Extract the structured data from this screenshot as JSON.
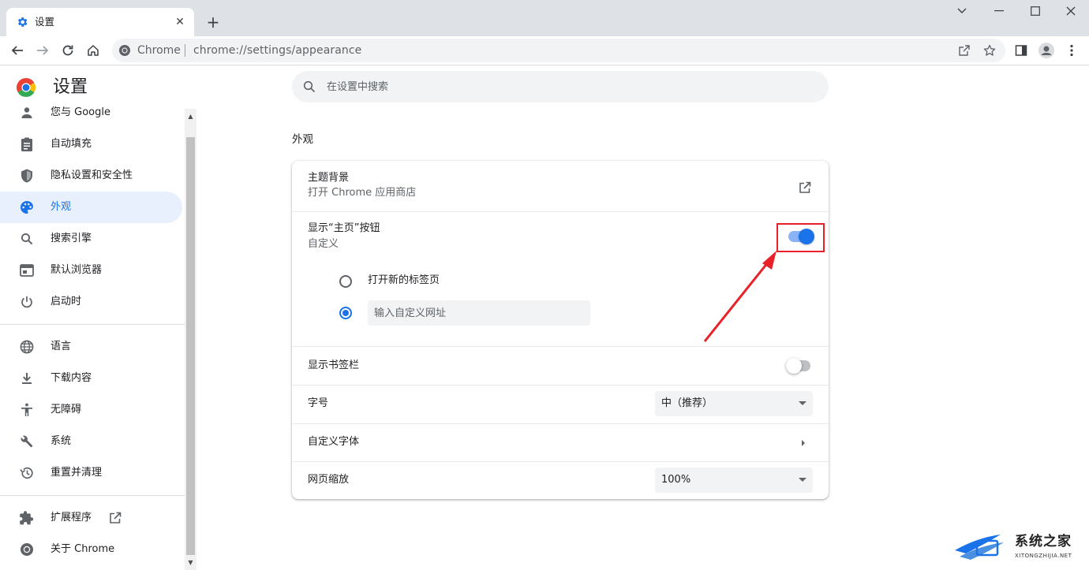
{
  "colors": {
    "accent": "#1a73e8",
    "accent_light": "#8ab4f8",
    "annotation_red": "#e8202a",
    "tabstrip": "#dee1e6"
  },
  "tab": {
    "title": "设置",
    "favicon": "gear-icon"
  },
  "window_controls": [
    "chevron-down-icon",
    "minimize-icon",
    "maximize-icon",
    "close-icon"
  ],
  "omnibox": {
    "site_label": "Chrome",
    "url": "chrome://settings/appearance"
  },
  "page": {
    "title": "设置",
    "search_placeholder": "在设置中搜索"
  },
  "sidebar": {
    "items": [
      {
        "id": "you-google",
        "label": "您与 Google",
        "icon": "person-icon",
        "active": false
      },
      {
        "id": "autofill",
        "label": "自动填充",
        "icon": "clipboard-icon",
        "active": false
      },
      {
        "id": "privacy",
        "label": "隐私设置和安全性",
        "icon": "shield-icon",
        "active": false
      },
      {
        "id": "appearance",
        "label": "外观",
        "icon": "palette-icon",
        "active": true
      },
      {
        "id": "search-engine",
        "label": "搜索引擎",
        "icon": "search-icon",
        "active": false
      },
      {
        "id": "default-browser",
        "label": "默认浏览器",
        "icon": "browser-icon",
        "active": false
      },
      {
        "id": "on-startup",
        "label": "启动时",
        "icon": "power-icon",
        "active": false
      },
      {
        "id": "languages",
        "label": "语言",
        "icon": "globe-icon",
        "active": false
      },
      {
        "id": "downloads",
        "label": "下载内容",
        "icon": "download-icon",
        "active": false
      },
      {
        "id": "accessibility",
        "label": "无障碍",
        "icon": "accessibility-icon",
        "active": false
      },
      {
        "id": "system",
        "label": "系统",
        "icon": "wrench-icon",
        "active": false
      },
      {
        "id": "reset",
        "label": "重置并清理",
        "icon": "history-icon",
        "active": false
      },
      {
        "id": "extensions",
        "label": "扩展程序",
        "icon": "puzzle-icon",
        "active": false
      },
      {
        "id": "about",
        "label": "关于 Chrome",
        "icon": "chrome-icon",
        "active": false
      }
    ]
  },
  "appearance": {
    "section_title": "外观",
    "theme": {
      "title": "主题背景",
      "subtitle": "打开 Chrome 应用商店"
    },
    "home_button": {
      "title": "显示“主页”按钮",
      "subtitle": "自定义",
      "enabled": true
    },
    "home_options": {
      "new_tab_label": "打开新的标签页",
      "custom_placeholder": "输入自定义网址",
      "selected": "custom"
    },
    "bookmarks_bar": {
      "title": "显示书签栏",
      "enabled": false
    },
    "font_size": {
      "title": "字号",
      "value": "中（推荐）"
    },
    "custom_fonts": {
      "title": "自定义字体"
    },
    "page_zoom": {
      "title": "网页缩放",
      "value": "100%"
    }
  },
  "watermark": {
    "brand": "系统之家",
    "url": "XITONGZHIJIA.NET"
  }
}
